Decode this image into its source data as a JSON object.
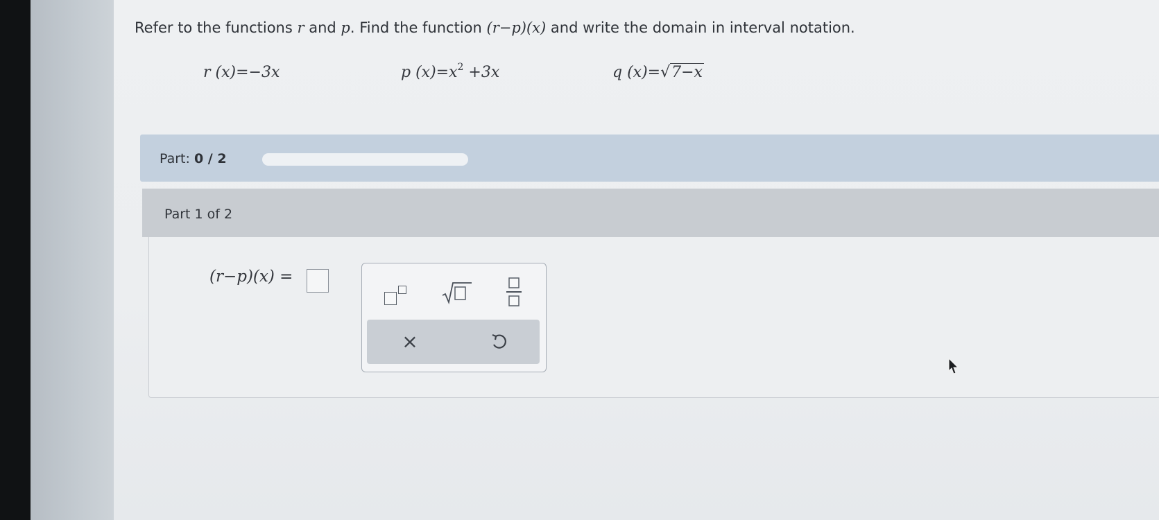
{
  "problem": {
    "text_prefix": "Refer to the functions ",
    "var_r": "r",
    "text_and": " and ",
    "var_p": "p",
    "text_find": ". Find the function ",
    "expr": "(r−p)(x)",
    "text_suffix": " and write the domain in interval notation."
  },
  "functions": {
    "r": "r (x)=−3x",
    "p_main": "p (x)=x",
    "p_exp": "2",
    "p_tail": " +3x",
    "q_lhs": "q (x)=",
    "q_radicand": "7−x"
  },
  "progress": {
    "label": "Part: ",
    "value": "0 / 2",
    "fraction": 0
  },
  "part": {
    "title": "Part 1 of 2",
    "answer_lhs": "(r−p)(x) ="
  },
  "palette": {
    "tools": [
      "exponent-icon",
      "square-root-icon",
      "fraction-icon"
    ],
    "clear_label": "×",
    "undo_icon": "undo-icon"
  },
  "colors": {
    "part_bar": "#c3d0de",
    "card_header": "#c8ccd1",
    "background": "#eceef0"
  }
}
